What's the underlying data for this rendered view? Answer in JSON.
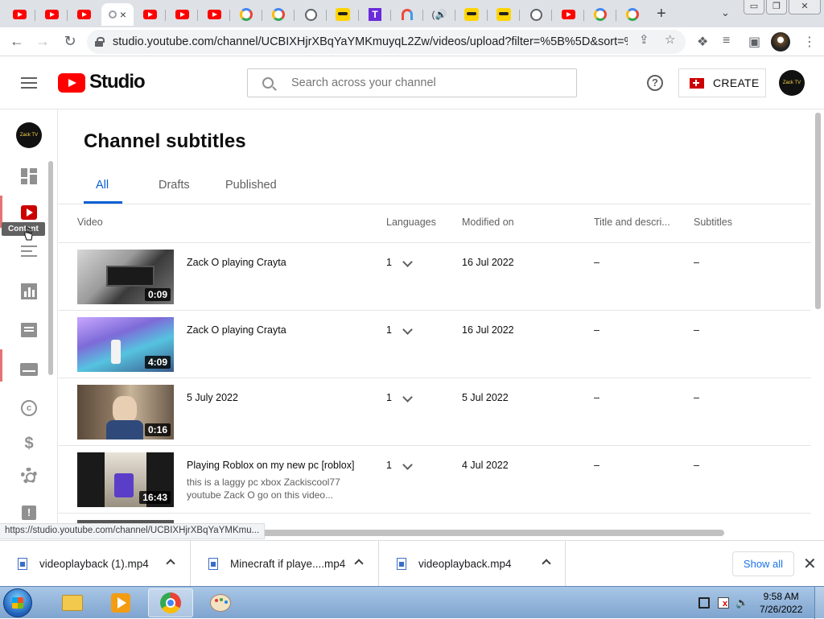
{
  "browser": {
    "tab_close_glyph": "×",
    "new_tab_glyph": "+",
    "tab_menu_glyph": "⌄",
    "window_buttons": [
      "▭",
      "❐",
      "✕"
    ],
    "url": "studio.youtube.com/channel/UCBIXHjrXBqYaYMKmuyqL2Zw/videos/upload?filter=%5B%5D&sort=%7...",
    "status_url": "https://studio.youtube.com/channel/UCBIXHjrXBqYaYMKmu..."
  },
  "studio": {
    "logo_text": "Studio",
    "search_placeholder": "Search across your channel",
    "help_glyph": "?",
    "create_label": "CREATE",
    "brand_color": "#ff0000",
    "accent_color": "#065fd4"
  },
  "rail": {
    "tooltip": "Content",
    "items": [
      "dashboard",
      "content",
      "playlists",
      "analytics",
      "comments",
      "subtitles",
      "copyright",
      "earn",
      "settings",
      "feedback"
    ]
  },
  "page": {
    "title": "Channel subtitles",
    "tabs": [
      "All",
      "Drafts",
      "Published"
    ],
    "active_tab": "All",
    "columns": [
      "Video",
      "Languages",
      "Modified on",
      "Title and descri...",
      "Subtitles"
    ],
    "rows": [
      {
        "title": "Zack O playing Crayta",
        "description": "",
        "duration": "0:09",
        "languages": "1",
        "modified": "16 Jul 2022",
        "title_desc": "–",
        "subtitles": "–"
      },
      {
        "title": "Zack O playing Crayta",
        "description": "",
        "duration": "4:09",
        "languages": "1",
        "modified": "16 Jul 2022",
        "title_desc": "–",
        "subtitles": "–"
      },
      {
        "title": "5 July 2022",
        "description": "",
        "duration": "0:16",
        "languages": "1",
        "modified": "5 Jul 2022",
        "title_desc": "–",
        "subtitles": "–"
      },
      {
        "title": "Playing Roblox on my new pc [roblox]",
        "description": "this is a laggy pc xbox Zackiscool77 youtube Zack O go on this video...",
        "duration": "16:43",
        "languages": "1",
        "modified": "4 Jul 2022",
        "title_desc": "–",
        "subtitles": "–"
      }
    ]
  },
  "downloads": {
    "items": [
      "videoplayback (1).mp4",
      "Minecraft if playe....mp4",
      "videoplayback.mp4"
    ],
    "show_all": "Show all",
    "close_glyph": "✕"
  },
  "taskbar": {
    "time": "9:58 AM",
    "date": "7/26/2022"
  }
}
